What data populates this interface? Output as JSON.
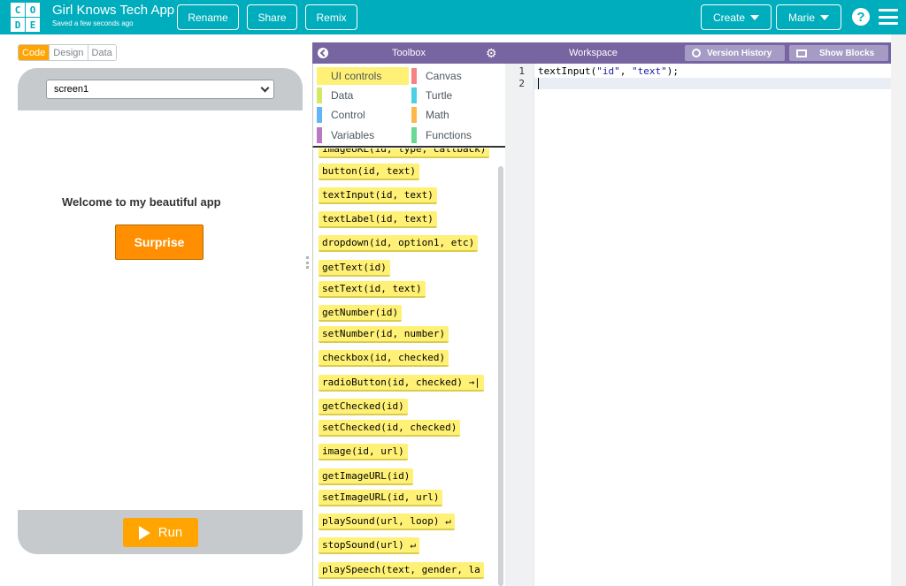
{
  "header": {
    "logo_letters": [
      "C",
      "O",
      "D",
      "E"
    ],
    "title": "Girl Knows Tech App",
    "saved": "Saved a few seconds ago",
    "buttons": {
      "rename": "Rename",
      "share": "Share",
      "remix": "Remix",
      "create": "Create",
      "user": "Marie"
    },
    "help": "?"
  },
  "mode_toggle": {
    "code": "Code",
    "design": "Design",
    "data": "Data"
  },
  "phone": {
    "screen_select": "screen1",
    "welcome_text": "Welcome to my beautiful app",
    "surprise_button": "Surprise",
    "run_button": "Run"
  },
  "toolbox": {
    "title": "Toolbox",
    "categories": [
      {
        "label": "UI controls",
        "color": "#fff176"
      },
      {
        "label": "Canvas",
        "color": "#f78183"
      },
      {
        "label": "Data",
        "color": "#d3e965"
      },
      {
        "label": "Turtle",
        "color": "#4dd0e1"
      },
      {
        "label": "Control",
        "color": "#64b5f6"
      },
      {
        "label": "Math",
        "color": "#ffb74d"
      },
      {
        "label": "Variables",
        "color": "#bb77c7"
      },
      {
        "label": "Functions",
        "color": "#68d995"
      }
    ],
    "blocks": [
      "imageURL(id, type, callback)",
      "button(id, text)",
      "textInput(id, text)",
      "textLabel(id, text)",
      "dropdown(id, option1, etc)",
      "getText(id)",
      "setText(id, text)",
      "getNumber(id)",
      "setNumber(id, number)",
      "checkbox(id, checked)",
      "radioButton(id, checked) →|",
      "getChecked(id)",
      "setChecked(id, checked)",
      "image(id, url)",
      "getImageURL(id)",
      "setImageURL(id, url)",
      "playSound(url, loop) ↵",
      "stopSound(url) ↵",
      "playSpeech(text, gender, la"
    ]
  },
  "workspace": {
    "title": "Workspace",
    "version_history": "Version History",
    "show_blocks": "Show Blocks",
    "line_numbers": [
      "1",
      "2"
    ],
    "code": {
      "fn": "textInput(",
      "arg1": "\"id\"",
      "sep": ", ",
      "arg2": "\"text\"",
      "end": ");"
    }
  }
}
